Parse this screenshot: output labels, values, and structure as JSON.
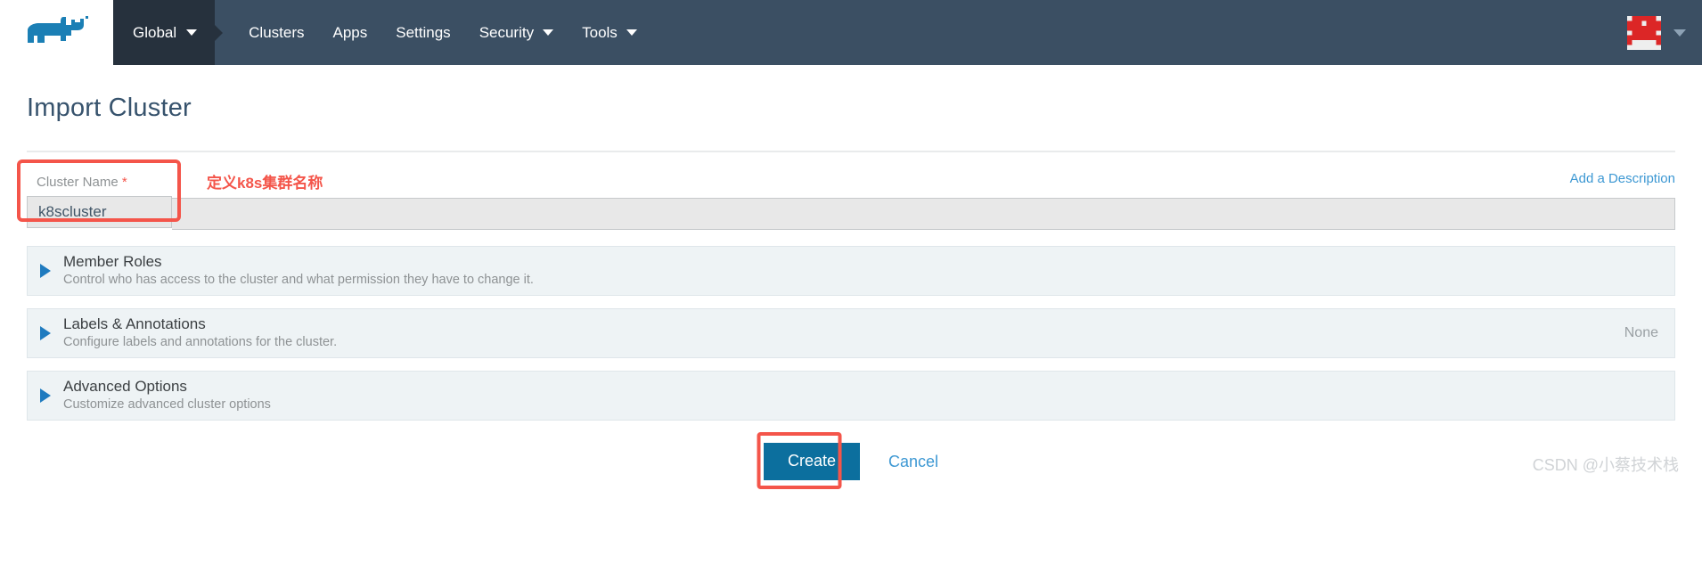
{
  "header": {
    "logo_icon": "rancher-cow-logo",
    "brand_color": "#1b7fb5",
    "nav_bg": "#3b4f63",
    "active_bg": "#26313d",
    "global": {
      "label": "Global",
      "caret_icon": "chevron-down-icon"
    },
    "items": [
      {
        "label": "Clusters",
        "has_caret": false
      },
      {
        "label": "Apps",
        "has_caret": false
      },
      {
        "label": "Settings",
        "has_caret": false
      },
      {
        "label": "Security",
        "has_caret": true
      },
      {
        "label": "Tools",
        "has_caret": true
      }
    ],
    "user": {
      "avatar_icon": "user-avatar-identicon",
      "avatar_color": "#dc2626",
      "caret_icon": "chevron-down-icon"
    }
  },
  "page": {
    "title": "Import Cluster"
  },
  "form": {
    "name_label": "Cluster Name",
    "name_required_mark": "*",
    "name_value": "k8scluster",
    "name_placeholder": "Cluster Name",
    "add_description_label": "Add a Description",
    "annotation_note": "定义k8s集群名称",
    "annotation_color": "#f4554a"
  },
  "sections": [
    {
      "title": "Member Roles",
      "subtitle": "Control who has access to the cluster and what permission they have to change it.",
      "right": "",
      "expander_icon": "triangle-right-icon"
    },
    {
      "title": "Labels & Annotations",
      "subtitle": "Configure labels and annotations for the cluster.",
      "right": "None",
      "expander_icon": "triangle-right-icon"
    },
    {
      "title": "Advanced Options",
      "subtitle": "Customize advanced cluster options",
      "right": "",
      "expander_icon": "triangle-right-icon"
    }
  ],
  "footer": {
    "create_label": "Create",
    "cancel_label": "Cancel",
    "create_color": "#0c6f9e"
  },
  "watermark": "CSDN @小蔡技术栈"
}
